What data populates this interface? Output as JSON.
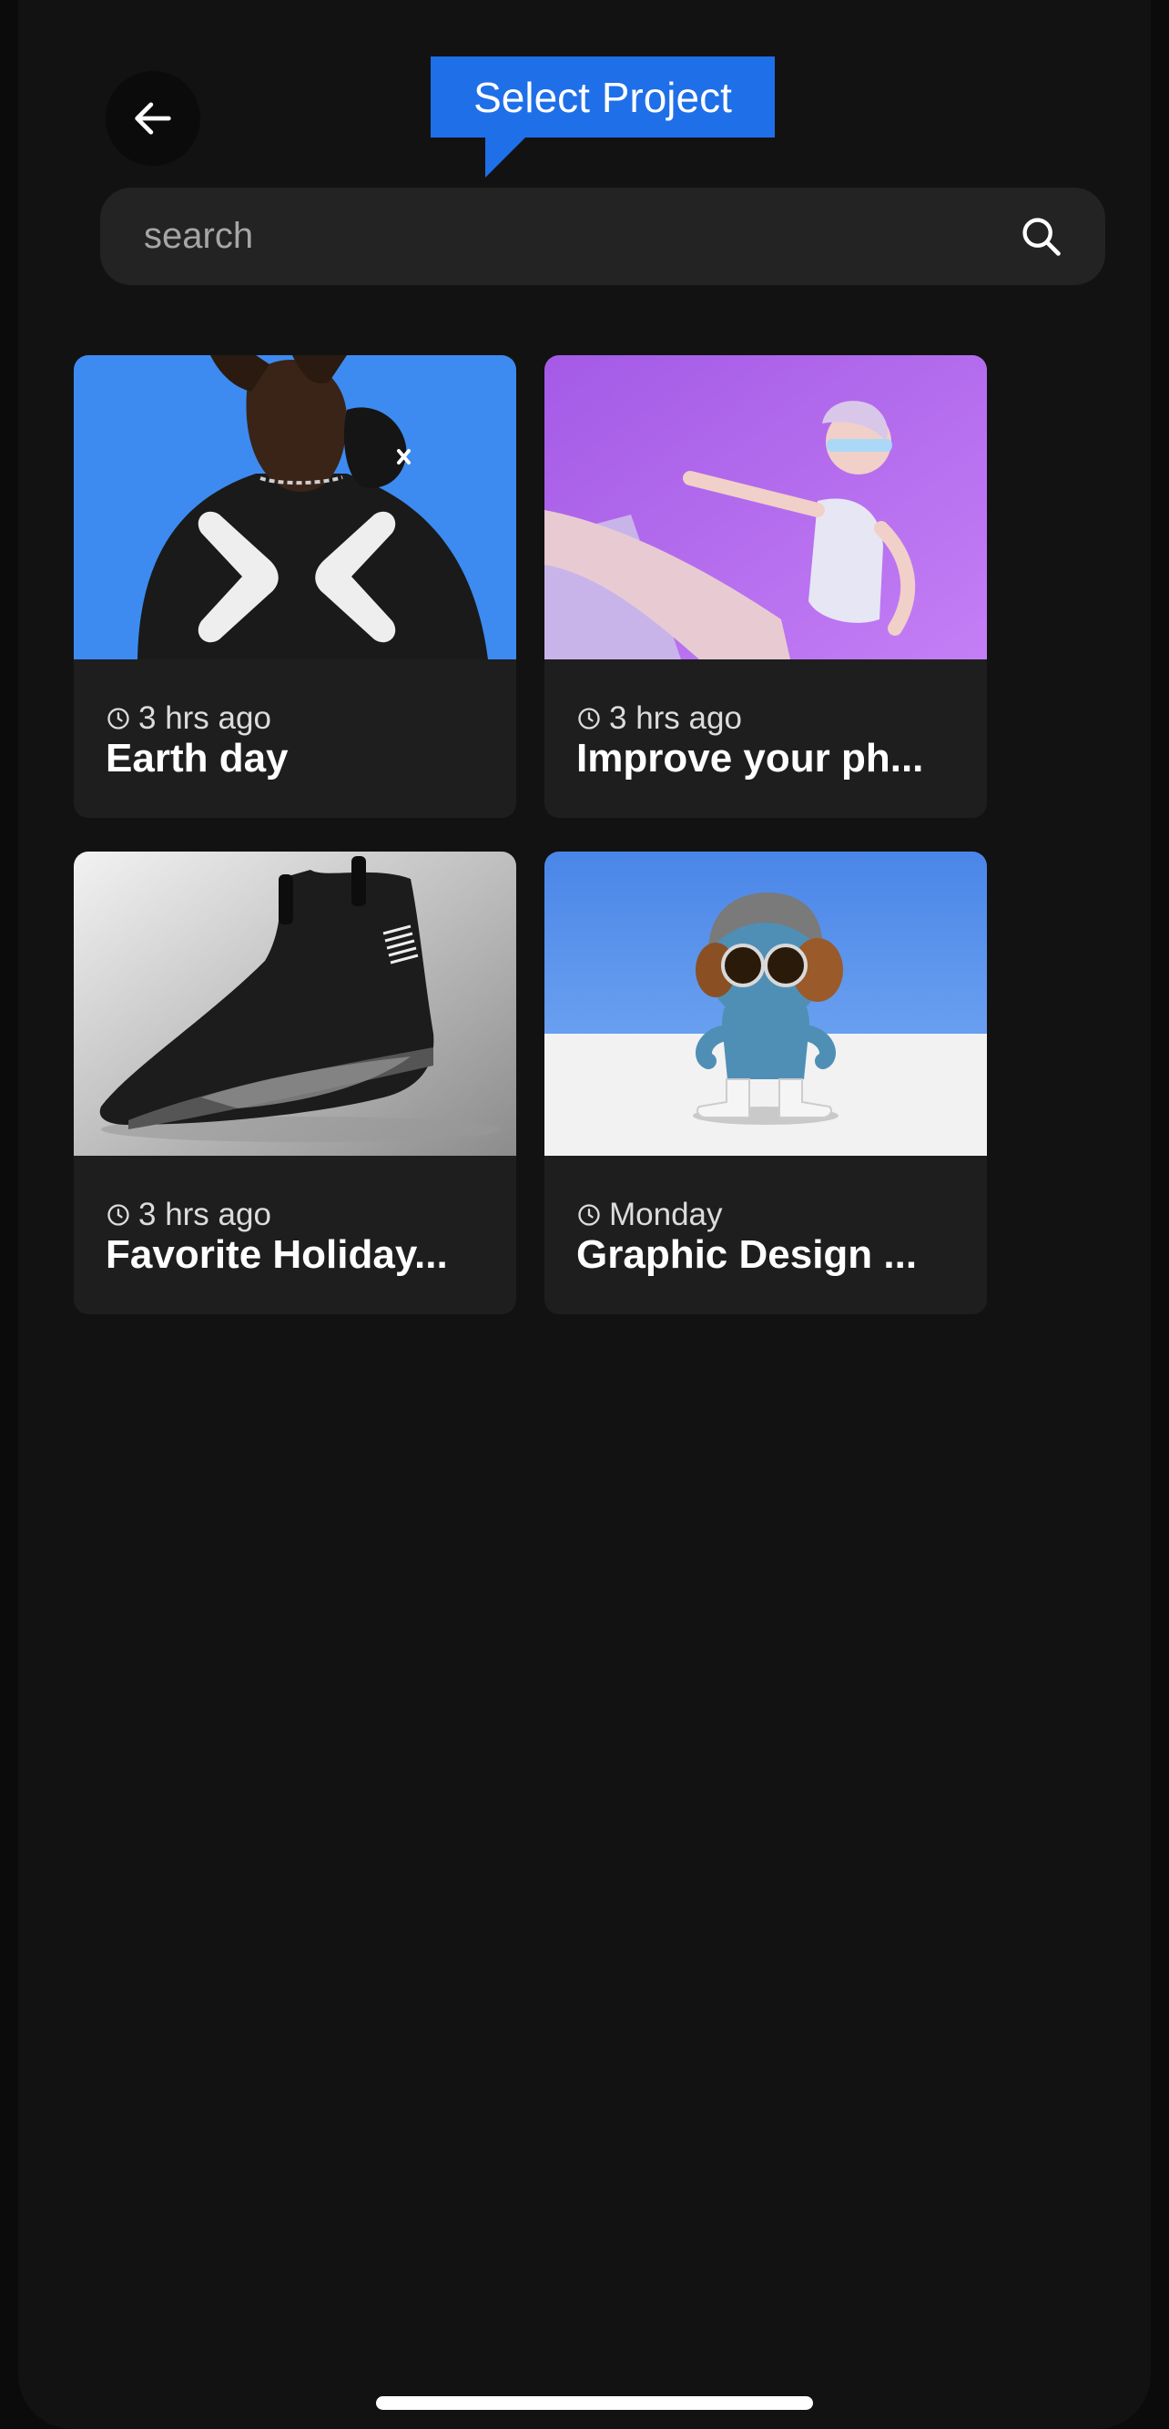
{
  "header": {
    "tooltip_label": "Select Project",
    "back_icon": "arrow-left-icon"
  },
  "search": {
    "placeholder": "search",
    "value": "",
    "icon": "search-icon"
  },
  "projects": [
    {
      "time": "3 hrs ago",
      "title": "Earth day",
      "thumbnail": "person in black mask and t-shirt on blue background"
    },
    {
      "time": "3 hrs ago",
      "title": "Improve your ph...",
      "thumbnail": "woman posing on purple background"
    },
    {
      "time": "3 hrs ago",
      "title": "Favorite Holiday...",
      "thumbnail": "black sneaker on grey background"
    },
    {
      "time": "Monday",
      "title": "Graphic Design ...",
      "thumbnail": "3D toy figure with headphones"
    }
  ],
  "colors": {
    "background": "#121212",
    "card": "#1e1e1e",
    "accent": "#1f6fe8",
    "search_bg": "#232323"
  }
}
